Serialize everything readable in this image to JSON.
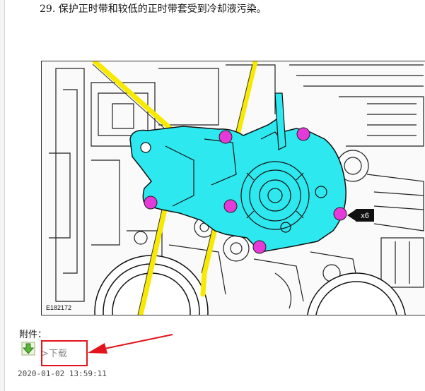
{
  "step": {
    "number": "29.",
    "text": "保护正时带和较低的正时带套受到冷却液污染。"
  },
  "figure": {
    "code": "E182172",
    "callout": "x6",
    "colors": {
      "part": "#2ee8ef",
      "belt": "#f7e900",
      "bolt": "#e43ad9",
      "line": "#111111"
    }
  },
  "attachment": {
    "label": "附件：",
    "download_text": ">下载",
    "icon": "green-download-arrow-icon",
    "highlight_color": "#e3141b"
  },
  "timestamp": "2020-01-02 13:59:11"
}
